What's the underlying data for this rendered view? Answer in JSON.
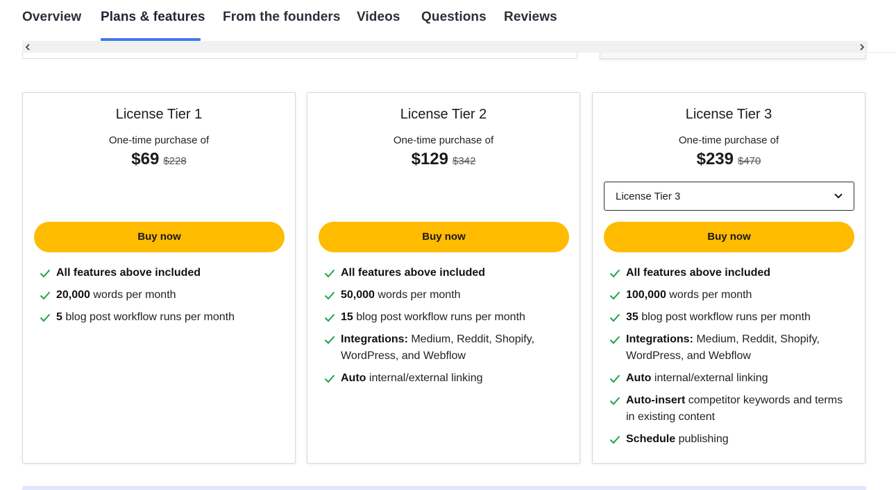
{
  "nav": {
    "tabs": [
      {
        "label": "Overview"
      },
      {
        "label": "Plans & features",
        "active": true
      },
      {
        "label": "From the founders"
      },
      {
        "label": "Videos"
      },
      {
        "label": "Questions"
      },
      {
        "label": "Reviews"
      }
    ]
  },
  "colors": {
    "accent": "#3e7be8",
    "buy_button": "#ffbb00",
    "check": "#1fa34a"
  },
  "plans": [
    {
      "title": "License Tier 1",
      "subtitle": "One-time purchase of",
      "price": "$69",
      "old_price": "$228",
      "buy_label": "Buy now",
      "features": [
        {
          "strong": "All features above included",
          "rest": ""
        },
        {
          "strong": "20,000",
          "rest": " words per month"
        },
        {
          "strong": "5",
          "rest": " blog post workflow runs per month"
        }
      ]
    },
    {
      "title": "License Tier 2",
      "subtitle": "One-time purchase of",
      "price": "$129",
      "old_price": "$342",
      "buy_label": "Buy now",
      "features": [
        {
          "strong": "All features above included",
          "rest": ""
        },
        {
          "strong": "50,000",
          "rest": " words per month"
        },
        {
          "strong": "15",
          "rest": " blog post workflow runs per month"
        },
        {
          "strong": "Integrations:",
          "rest": " Medium, Reddit, Shopify, WordPress, and Webflow"
        },
        {
          "strong": "Auto",
          "rest": " internal/external linking"
        }
      ]
    },
    {
      "title": "License Tier 3",
      "subtitle": "One-time purchase of",
      "price": "$239",
      "old_price": "$470",
      "select_value": "License Tier 3",
      "buy_label": "Buy now",
      "features": [
        {
          "strong": "All features above included",
          "rest": ""
        },
        {
          "strong": "100,000",
          "rest": " words per month"
        },
        {
          "strong": "35",
          "rest": " blog post workflow runs per month"
        },
        {
          "strong": "Integrations:",
          "rest": " Medium, Reddit, Shopify, WordPress, and Webflow"
        },
        {
          "strong": "Auto",
          "rest": " internal/external linking"
        },
        {
          "strong": "Auto-insert",
          "rest": " competitor keywords and terms in existing content"
        },
        {
          "strong": "Schedule",
          "rest": " publishing"
        }
      ]
    }
  ],
  "icons": {
    "scroll_left": "chevron-left-icon",
    "scroll_right": "chevron-right-icon",
    "select": "chevron-down-icon",
    "feature": "check-icon"
  }
}
